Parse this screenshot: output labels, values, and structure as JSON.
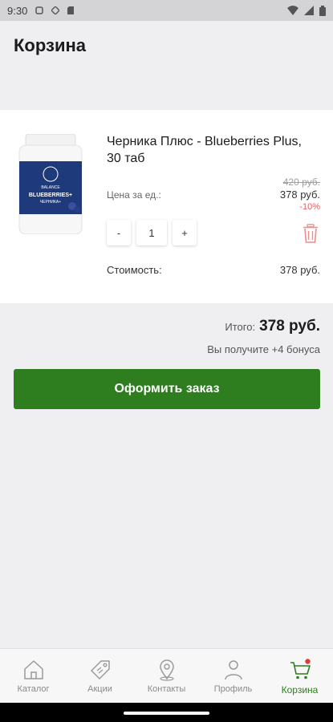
{
  "status_bar": {
    "time": "9:30"
  },
  "page": {
    "title": "Корзина"
  },
  "cart_item": {
    "image": {
      "brand": "BALANCE",
      "product": "BLUEBERRIES+",
      "subtitle": "ЧЕРНИКА+"
    },
    "name": "Черника Плюс - Blueberries Plus, 30 таб",
    "unit_price_label": "Цена за ед.:",
    "old_price": "420 руб.",
    "unit_price": "378 руб.",
    "discount": "-10%",
    "quantity": {
      "minus_label": "-",
      "value": "1",
      "plus_label": "+"
    },
    "total_label": "Стоимость:",
    "total_value": "378 руб."
  },
  "summary": {
    "total_label": "Итого:",
    "total_value": "378 руб.",
    "bonus_text": "Вы получите +4 бонуса"
  },
  "checkout_button": {
    "label": "Оформить заказ"
  },
  "tabbar": {
    "items": [
      {
        "label": "Каталог",
        "icon": "home-icon"
      },
      {
        "label": "Акции",
        "icon": "tag-icon"
      },
      {
        "label": "Контакты",
        "icon": "location-pin-icon"
      },
      {
        "label": "Профиль",
        "icon": "user-icon"
      },
      {
        "label": "Корзина",
        "icon": "cart-icon"
      }
    ],
    "active_color": "#2e7d1f",
    "inactive_color": "#8a8a8a"
  },
  "colors": {
    "accent": "#2e7d1f",
    "discount": "#e06060",
    "trash": "#f08c8c",
    "badge": "#e53935"
  }
}
